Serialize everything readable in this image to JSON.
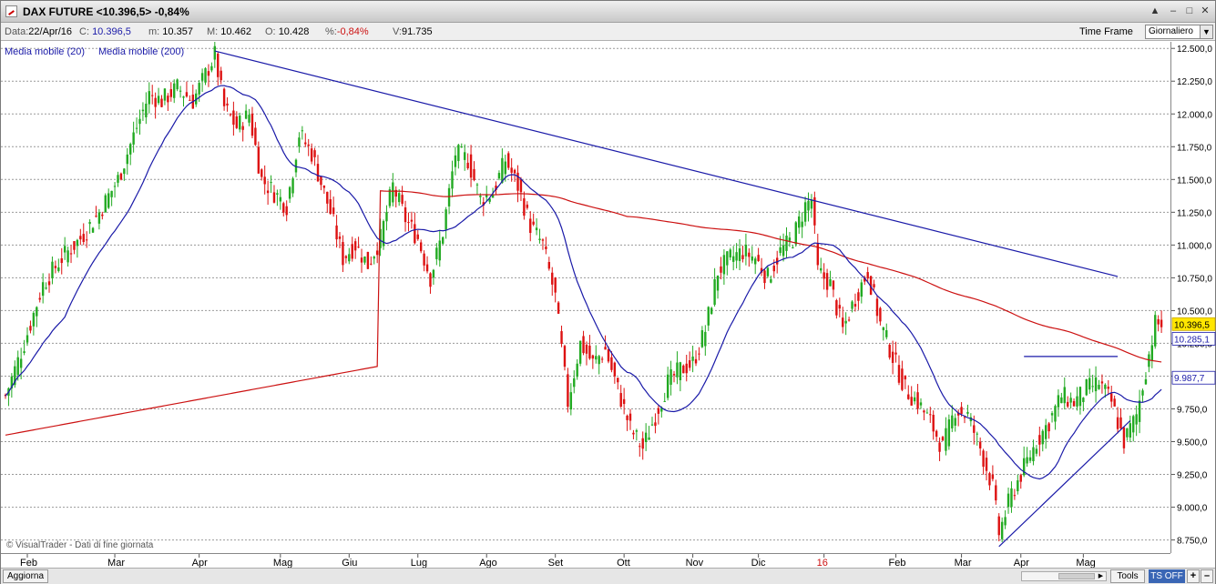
{
  "window": {
    "title": "DAX FUTURE <10.396,5> -0,84%",
    "buttons": [
      "▲",
      "–",
      "□",
      "✕"
    ]
  },
  "info": {
    "data_label": "Data:",
    "data_value": "22/Apr/16",
    "c_label": "C:",
    "c_value": "10.396,5",
    "m_label": "m:",
    "m_value": "10.357",
    "M_label": "M:",
    "M_value": "10.462",
    "o_label": "O:",
    "o_value": "10.428",
    "pct_label": "%:",
    "pct_value": "-0,84%",
    "v_label": "V:",
    "v_value": "91.735",
    "timeframe_label": "Time Frame",
    "timeframe_value": "Giornaliero"
  },
  "legend": {
    "ma20": "Media mobile (20)",
    "ma200": "Media mobile (200)"
  },
  "copyright": "© VisualTrader - Dati di fine giornata",
  "bottom": {
    "aggiorna": "Aggiorna",
    "tools": "Tools",
    "tsoff": "TS OFF",
    "plus": "+",
    "minus": "–"
  },
  "colors": {
    "up": "#22aa22",
    "down": "#dd1111",
    "ma20": "#1a1aa8",
    "ma200": "#cc1111",
    "trend": "#1a1aa8",
    "grid": "#999999",
    "price_tag": "#ffe600"
  },
  "chart_data": {
    "type": "candlestick",
    "title": "DAX FUTURE",
    "ylim": [
      8650,
      12550
    ],
    "y_ticks": [
      "12.500,0",
      "12.250,0",
      "12.000,0",
      "11.750,0",
      "11.500,0",
      "11.250,0",
      "11.000,0",
      "10.750,0",
      "10.500,0",
      "10.250,0",
      "10.000,0",
      "9.750,0",
      "9.500,0",
      "9.250,0",
      "9.000,0",
      "8.750,0"
    ],
    "y_tick_values": [
      12500,
      12250,
      12000,
      11750,
      11500,
      11250,
      11000,
      10750,
      10500,
      10250,
      10000,
      9750,
      9500,
      9250,
      9000,
      8750
    ],
    "x_months": [
      "Feb",
      "Mar",
      "Apr",
      "Mag",
      "Giu",
      "Lug",
      "Ago",
      "Set",
      "Ott",
      "Nov",
      "Dic",
      "16",
      "Feb",
      "Mar",
      "Apr",
      "Mag"
    ],
    "x_month_days": [
      7,
      35,
      62,
      88,
      110,
      132,
      154,
      176,
      198,
      220,
      241,
      262,
      285,
      306,
      325,
      345
    ],
    "total_days": 350,
    "price_tags": [
      {
        "label": "10.396,5",
        "value": 10396.5,
        "style": "current"
      },
      {
        "label": "10.285,1",
        "value": 10285.1,
        "style": "ma200"
      },
      {
        "label": "9.987,7",
        "value": 9987.7,
        "style": "ma20"
      }
    ],
    "close_path": [
      [
        0,
        9850
      ],
      [
        6,
        10250
      ],
      [
        12,
        10700
      ],
      [
        18,
        10900
      ],
      [
        24,
        11050
      ],
      [
        30,
        11250
      ],
      [
        36,
        11500
      ],
      [
        42,
        11900
      ],
      [
        46,
        12150
      ],
      [
        50,
        12100
      ],
      [
        55,
        12200
      ],
      [
        60,
        12100
      ],
      [
        64,
        12300
      ],
      [
        67,
        12450
      ],
      [
        70,
        12050
      ],
      [
        74,
        11900
      ],
      [
        78,
        12000
      ],
      [
        82,
        11500
      ],
      [
        86,
        11400
      ],
      [
        90,
        11300
      ],
      [
        94,
        11850
      ],
      [
        98,
        11700
      ],
      [
        104,
        11250
      ],
      [
        108,
        10900
      ],
      [
        112,
        11000
      ],
      [
        116,
        10850
      ],
      [
        120,
        11050
      ],
      [
        124,
        11450
      ],
      [
        128,
        11200
      ],
      [
        132,
        11050
      ],
      [
        136,
        10750
      ],
      [
        140,
        11100
      ],
      [
        144,
        11700
      ],
      [
        148,
        11650
      ],
      [
        152,
        11350
      ],
      [
        156,
        11400
      ],
      [
        160,
        11650
      ],
      [
        164,
        11450
      ],
      [
        168,
        11150
      ],
      [
        172,
        11000
      ],
      [
        176,
        10600
      ],
      [
        180,
        9800
      ],
      [
        184,
        10250
      ],
      [
        188,
        10100
      ],
      [
        192,
        10200
      ],
      [
        196,
        9900
      ],
      [
        200,
        9600
      ],
      [
        204,
        9450
      ],
      [
        208,
        9700
      ],
      [
        212,
        9950
      ],
      [
        216,
        10050
      ],
      [
        220,
        10100
      ],
      [
        224,
        10350
      ],
      [
        228,
        10800
      ],
      [
        232,
        10900
      ],
      [
        236,
        10950
      ],
      [
        240,
        10900
      ],
      [
        244,
        10750
      ],
      [
        248,
        10950
      ],
      [
        252,
        11050
      ],
      [
        256,
        11300
      ],
      [
        258,
        11350
      ],
      [
        260,
        10800
      ],
      [
        264,
        10700
      ],
      [
        268,
        10350
      ],
      [
        272,
        10600
      ],
      [
        276,
        10800
      ],
      [
        280,
        10400
      ],
      [
        284,
        10150
      ],
      [
        288,
        9900
      ],
      [
        292,
        9800
      ],
      [
        296,
        9650
      ],
      [
        300,
        9450
      ],
      [
        304,
        9750
      ],
      [
        308,
        9700
      ],
      [
        312,
        9450
      ],
      [
        316,
        9150
      ],
      [
        318,
        8800
      ],
      [
        322,
        9100
      ],
      [
        326,
        9300
      ],
      [
        330,
        9500
      ],
      [
        334,
        9650
      ],
      [
        338,
        9850
      ],
      [
        342,
        9800
      ],
      [
        346,
        9900
      ],
      [
        350,
        9950
      ],
      [
        354,
        9800
      ],
      [
        358,
        9500
      ],
      [
        362,
        9700
      ],
      [
        365,
        10050
      ],
      [
        368,
        10400
      ],
      [
        370,
        10396
      ]
    ],
    "trendlines": [
      {
        "from": [
          67,
          12480
        ],
        "to": [
          356,
          10760
        ]
      },
      {
        "from": [
          318,
          8700
        ],
        "to": [
          360,
          9660
        ]
      },
      {
        "from": [
          326,
          10150
        ],
        "to": [
          356,
          10150
        ]
      }
    ]
  }
}
